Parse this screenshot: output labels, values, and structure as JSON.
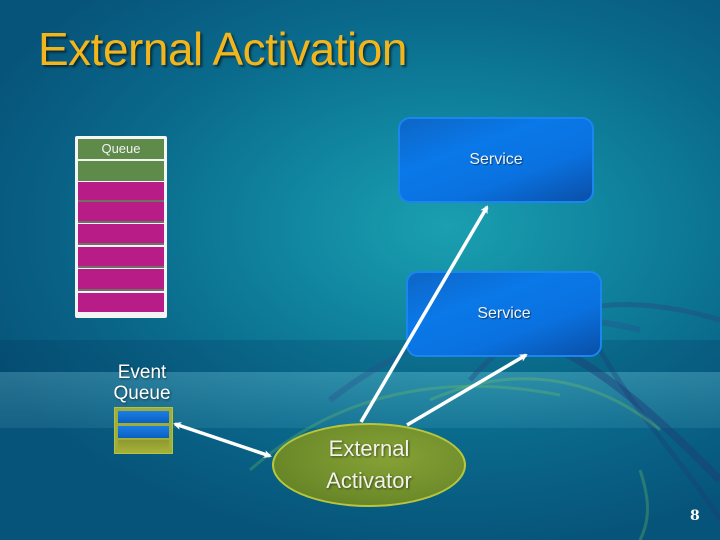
{
  "slide": {
    "title": "External Activation",
    "page_number": "8"
  },
  "queue": {
    "label": "Queue",
    "message_count": 6,
    "colors": {
      "header": "#5e8a4a",
      "message": "#b81c86",
      "border": "#f4f4f4"
    }
  },
  "services": [
    {
      "label": "Service"
    },
    {
      "label": "Service"
    }
  ],
  "event_queue": {
    "label_line1": "Event",
    "label_line2": "Queue",
    "cells": [
      "blue",
      "blue",
      "olive"
    ]
  },
  "activator": {
    "label_line1": "External",
    "label_line2": "Activator",
    "color": "#6e8c2a"
  },
  "connections": [
    {
      "from": "activator",
      "to": "service-1",
      "direction": "one-way"
    },
    {
      "from": "activator",
      "to": "service-2",
      "direction": "one-way"
    },
    {
      "from": "activator",
      "to": "event_queue",
      "direction": "two-way"
    }
  ],
  "colors": {
    "title": "#f2b51c",
    "service_fill": "#0a78e8",
    "background": "#0a6a8c"
  }
}
